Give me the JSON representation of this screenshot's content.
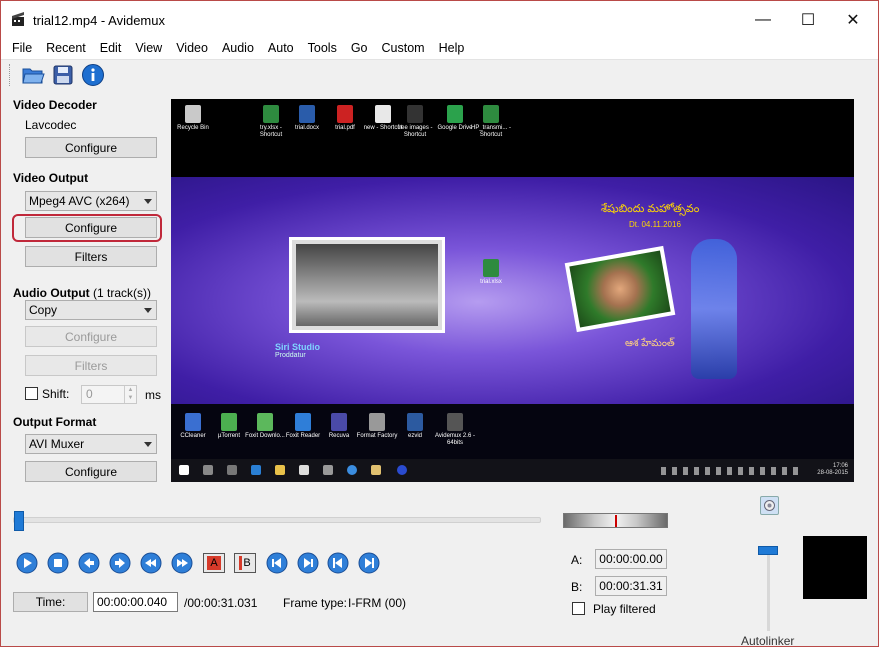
{
  "window": {
    "title": "trial12.mp4 - Avidemux",
    "minimize": "—",
    "maximize": "☐",
    "close": "✕"
  },
  "menu": [
    "File",
    "Recent",
    "Edit",
    "View",
    "Video",
    "Audio",
    "Auto",
    "Tools",
    "Go",
    "Custom",
    "Help"
  ],
  "toolbar": {
    "icons": [
      "open-folder-icon",
      "save-icon",
      "info-icon"
    ]
  },
  "left_panel": {
    "video_decoder": {
      "heading": "Video Decoder",
      "codec": "Lavcodec",
      "configure": "Configure"
    },
    "video_output": {
      "heading": "Video Output",
      "selected": "Mpeg4 AVC (x264)",
      "configure": "Configure",
      "filters": "Filters"
    },
    "audio_output": {
      "heading": "Audio Output",
      "tracks": "(1 track(s))",
      "selected": "Copy",
      "configure": "Configure",
      "filters": "Filters",
      "shift_label": "Shift:",
      "shift_value": "0",
      "shift_unit": "ms"
    },
    "output_format": {
      "heading": "Output Format",
      "selected": "AVI Muxer",
      "configure": "Configure"
    }
  },
  "preview": {
    "desktop_icons": [
      {
        "label": "Recycle Bin",
        "color": "#c9c9c9"
      },
      {
        "label": "try.xlsx - Shortcut",
        "color": "#2e8b3f"
      },
      {
        "label": "trial.docx",
        "color": "#2a5caa"
      },
      {
        "label": "trial.pdf",
        "color": "#c22"
      },
      {
        "label": "new - Shortcut",
        "color": "#e8e8e8"
      },
      {
        "label": "free images - Shortcut",
        "color": "#333"
      },
      {
        "label": "Google Drive",
        "color": "#2ba24c"
      },
      {
        "label": "HP_transmi... - Shortcut",
        "color": "#2e8b3f"
      }
    ],
    "floating_icon": "trial.xlsx",
    "taskbar_apps": [
      {
        "label": "CCleaner",
        "color": "#3a6fd1"
      },
      {
        "label": "µTorrent",
        "color": "#4caf50"
      },
      {
        "label": "Foxit Downlo...",
        "color": "#5cb85c"
      },
      {
        "label": "Foxit Reader",
        "color": "#2f7ed8"
      },
      {
        "label": "Recuva",
        "color": "#4a4aa8"
      },
      {
        "label": "Format Factory",
        "color": "#999"
      },
      {
        "label": "ezvid",
        "color": "#2c5aa0"
      },
      {
        "label": "Avidemux 2.6 - 64bits",
        "color": "#555"
      }
    ],
    "telugu_title": "శేషుబిందు మహోత్సవం",
    "telugu_date": "Dt. 04.11.2016",
    "telugu_name": "ఆశ హేమంత్",
    "logo_line1": "Siri Studio",
    "logo_line2": "Proddatur",
    "clock_time": "17:06",
    "clock_date": "28-08-2015"
  },
  "transport": {
    "controls": [
      "play-icon",
      "stop-icon",
      "previous-frame-icon",
      "next-frame-icon",
      "rewind-icon",
      "fast-forward-icon",
      "set-marker-a-icon",
      "set-marker-b-icon",
      "previous-keyframe-icon",
      "next-keyframe-icon",
      "go-to-start-icon",
      "go-to-end-icon"
    ],
    "marker_a": "A",
    "marker_b": "B",
    "position": 0.0013
  },
  "time": {
    "button": "Time:",
    "current": "00:00:00.040",
    "total": "/00:00:31.031",
    "frame_type_label": "Frame type:",
    "frame_type": "I-FRM (00)"
  },
  "markers": {
    "a_label": "A:",
    "a_value": "00:00:00.00",
    "b_label": "B:",
    "b_value": "00:00:31.31",
    "play_filtered": "Play filtered"
  },
  "background": {
    "autolinker": "Autolinker"
  }
}
